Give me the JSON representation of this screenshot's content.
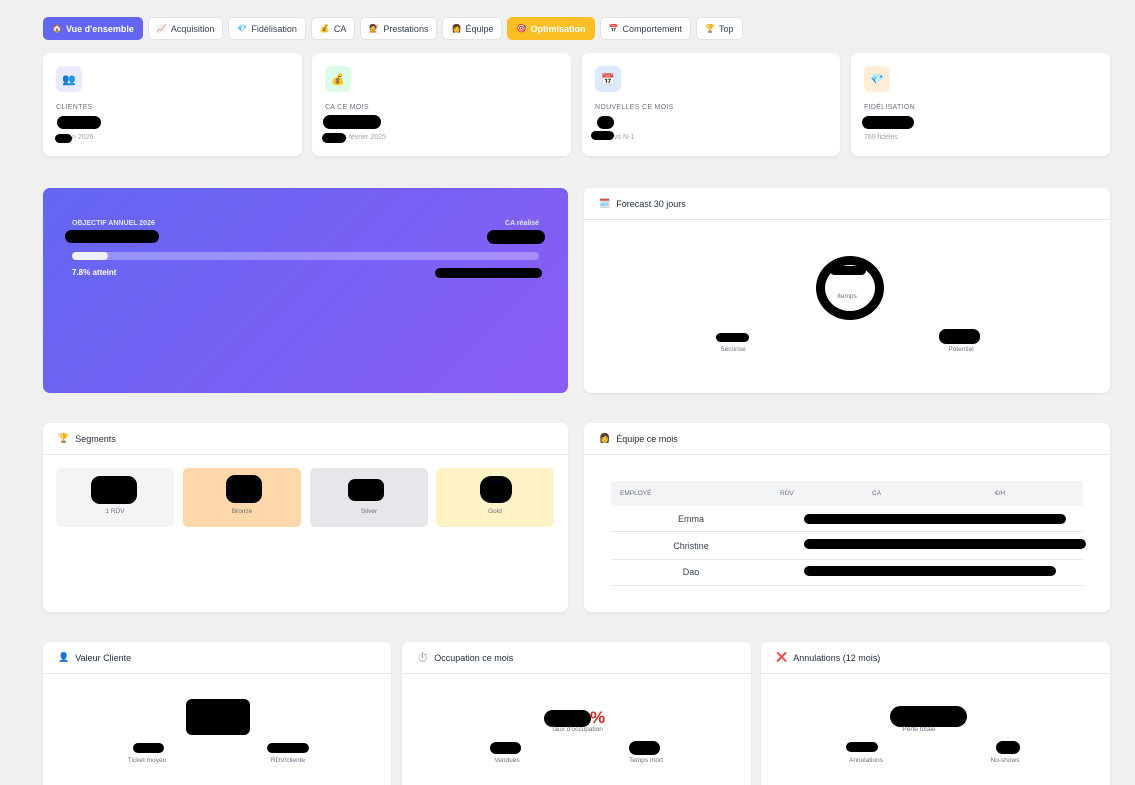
{
  "tabs": [
    {
      "icon": "🏠",
      "label": "Vue d'ensemble",
      "state": "active"
    },
    {
      "icon": "📈",
      "label": "Acquisition"
    },
    {
      "icon": "💎",
      "label": "Fidélisation"
    },
    {
      "icon": "💰",
      "label": "CA"
    },
    {
      "icon": "💇",
      "label": "Prestations"
    },
    {
      "icon": "👩",
      "label": "Équipe"
    },
    {
      "icon": "🎯",
      "label": "Optimisation",
      "state": "highlight"
    },
    {
      "icon": "📅",
      "label": "Comportement"
    },
    {
      "icon": "🏆",
      "label": "Top"
    }
  ],
  "kpis": [
    {
      "icon": "👥",
      "label": "CLIENTES",
      "sub": "n 2026",
      "icon_bg": "#ede9fe"
    },
    {
      "icon": "💰",
      "label": "CA CE MOIS",
      "sub": "vs février 2025",
      "icon_bg": "#dcfce7"
    },
    {
      "icon": "📅",
      "label": "NOUVELLES CE MOIS",
      "sub": "vs N-1",
      "icon_bg": "#dbeafe"
    },
    {
      "icon": "💎",
      "label": "FIDÉLISATION",
      "sub": "760 fidèles",
      "icon_bg": "#ffedd5"
    }
  ],
  "objective": {
    "label": "OBJECTIF ANNUEL 2026",
    "right_label": "CA réalisé",
    "progress_pct": 7.8,
    "progress_text": "7.8% atteint"
  },
  "forecast": {
    "icon": "🗓️",
    "title": "Forecast 30 jours",
    "center_label": "Itemps",
    "left_label": "Sécurisé",
    "right_label": "Potentiel"
  },
  "segments": {
    "icon": "🏆",
    "title": "Segments",
    "items": [
      {
        "label": "1 RDV",
        "bg": "#f3f4f6"
      },
      {
        "label": "Bronze",
        "bg": "#fed7aa"
      },
      {
        "label": "Silver",
        "bg": "#e5e7eb"
      },
      {
        "label": "Gold",
        "bg": "#fef3c7"
      }
    ]
  },
  "team": {
    "icon": "👩",
    "title": "Équipe ce mois",
    "headers": [
      "EMPLOYÉ",
      "RDV",
      "CA",
      "€/H"
    ],
    "rows": [
      "Emma",
      "Christine",
      "Dao"
    ]
  },
  "value": {
    "icon": "👤",
    "title": "Valeur Cliente",
    "left_label": "Ticket moyen",
    "right_label": "RDV/cliente"
  },
  "occupation": {
    "icon": "⏱️",
    "title": "Occupation ce mois",
    "center_label": "Taux d'occupation",
    "center_suffix": "%",
    "left_label": "Vendues",
    "right_label": "Temps mort"
  },
  "cancellations": {
    "icon": "❌",
    "title": "Annulations (12 mois)",
    "center_label": "Perte totale",
    "left_label": "Annulations",
    "right_label": "No-shows"
  },
  "colors": {
    "accent": "#6366f1",
    "highlight": "#fbbf24",
    "danger": "#dc2626"
  }
}
